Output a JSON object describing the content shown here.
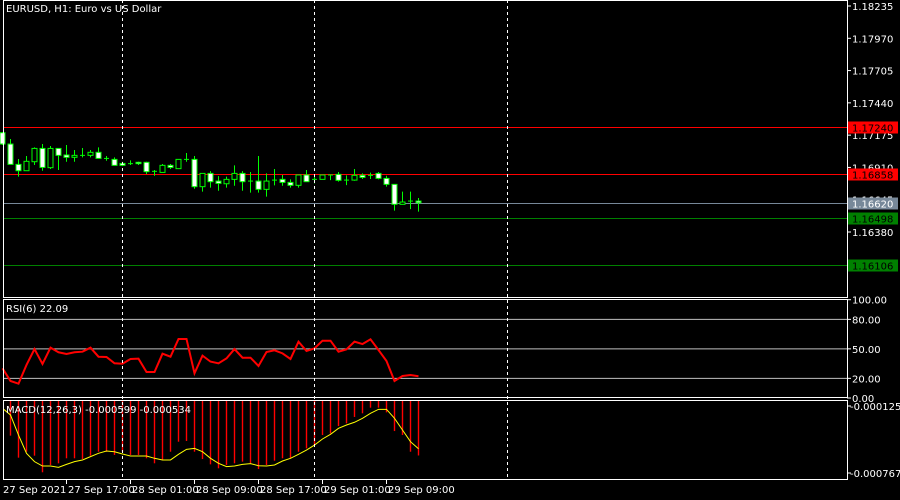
{
  "window": {
    "title": "EURUSD, H1:  Euro vs US Dollar"
  },
  "colors": {
    "background": "#000000",
    "bull": "#00ff00",
    "bear_fill": "#ffffff",
    "rsi": "#ff0000",
    "macd_hist": "#ff0000",
    "macd_signal": "#ffff00",
    "axis": "#ffffff",
    "grid": "#c0c0c0"
  },
  "chart_data": [
    {
      "type": "candlestick",
      "symbol": "EURUSD",
      "timeframe": "H1",
      "title": "EURUSD, H1:  Euro vs US Dollar",
      "ylim": [
        1.159,
        1.1828
      ],
      "y_ticks": [
        "1.18235",
        "1.17970",
        "1.17705",
        "1.17440",
        "1.17175",
        "1.16910",
        "1.16645",
        "1.16380"
      ],
      "x_ticks": [
        "27 Sep 2021",
        "27 Sep 17:00",
        "28 Sep 01:00",
        "28 Sep 09:00",
        "28 Sep 17:00",
        "29 Sep 01:00",
        "29 Sep 09:00"
      ],
      "day_separators": [
        "28 Sep 00:00",
        "29 Sep 00:00",
        "30 Sep 00:00"
      ],
      "ohlc": [
        [
          1.17195,
          1.17201,
          1.17094,
          1.17102
        ],
        [
          1.17102,
          1.17143,
          1.16935,
          1.16935
        ],
        [
          1.16935,
          1.16979,
          1.16834,
          1.16883
        ],
        [
          1.16883,
          1.17004,
          1.16883,
          1.1696
        ],
        [
          1.16957,
          1.17075,
          1.1693,
          1.17066
        ],
        [
          1.17066,
          1.17102,
          1.16883,
          1.1691
        ],
        [
          1.16908,
          1.17086,
          1.16897,
          1.17066
        ],
        [
          1.17066,
          1.17066,
          1.16889,
          1.17009
        ],
        [
          1.17012,
          1.17094,
          1.16957,
          1.16993
        ],
        [
          1.16993,
          1.17053,
          1.16957,
          1.17009
        ],
        [
          1.17009,
          1.17069,
          1.16993,
          1.17009
        ],
        [
          1.17009,
          1.17053,
          1.16993,
          1.17034
        ],
        [
          1.17034,
          1.17075,
          1.16984,
          1.16984
        ],
        [
          1.16984,
          1.17004,
          1.16965,
          1.16984
        ],
        [
          1.16976,
          1.16993,
          1.16927,
          1.16927
        ],
        [
          1.16943,
          1.16957,
          1.16921,
          1.16927
        ],
        [
          1.16941,
          1.16968,
          1.1693,
          1.16941
        ],
        [
          1.16952,
          1.16957,
          1.1693,
          1.16941
        ],
        [
          1.16952,
          1.16957,
          1.16856,
          1.16875
        ],
        [
          1.16878,
          1.16889,
          1.16842,
          1.16869
        ],
        [
          1.16869,
          1.16938,
          1.16869,
          1.16927
        ],
        [
          1.16927,
          1.16938,
          1.16897,
          1.1691
        ],
        [
          1.169,
          1.16976,
          1.169,
          1.16976
        ],
        [
          1.16976,
          1.17028,
          1.16957,
          1.16976
        ],
        [
          1.16976,
          1.17004,
          1.16735,
          1.16752
        ],
        [
          1.16752,
          1.16861,
          1.16711,
          1.16861
        ],
        [
          1.16861,
          1.1688,
          1.16744,
          1.16793
        ],
        [
          1.16798,
          1.16839,
          1.16719,
          1.16779
        ],
        [
          1.16776,
          1.16834,
          1.16744,
          1.16812
        ],
        [
          1.16812,
          1.16927,
          1.1676,
          1.16861
        ],
        [
          1.16861,
          1.1688,
          1.16719,
          1.16793
        ],
        [
          1.16798,
          1.16872,
          1.16703,
          1.16798
        ],
        [
          1.16798,
          1.17004,
          1.16703,
          1.1673
        ],
        [
          1.1673,
          1.16861,
          1.1667,
          1.16798
        ],
        [
          1.16806,
          1.16897,
          1.16763,
          1.16806
        ],
        [
          1.16812,
          1.16848,
          1.1676,
          1.16787
        ],
        [
          1.16787,
          1.16812,
          1.16744,
          1.16763
        ],
        [
          1.16763,
          1.16848,
          1.16744,
          1.16848
        ],
        [
          1.16848,
          1.16889,
          1.16793,
          1.16793
        ],
        [
          1.16812,
          1.16848,
          1.16779,
          1.16812
        ],
        [
          1.16812,
          1.16848,
          1.16812,
          1.16848
        ],
        [
          1.16848,
          1.16848,
          1.16806,
          1.16848
        ],
        [
          1.16853,
          1.16872,
          1.16793,
          1.16804
        ],
        [
          1.16806,
          1.16845,
          1.16765,
          1.16806
        ],
        [
          1.16806,
          1.16897,
          1.16801,
          1.16845
        ],
        [
          1.16845,
          1.16861,
          1.16815,
          1.16828
        ],
        [
          1.16845,
          1.16867,
          1.16815,
          1.16845
        ],
        [
          1.16861,
          1.16872,
          1.16812,
          1.1682
        ],
        [
          1.1682,
          1.16842,
          1.16752,
          1.16771
        ],
        [
          1.16771,
          1.16771,
          1.16555,
          1.16607
        ],
        [
          1.16607,
          1.16711,
          1.16607,
          1.16626
        ],
        [
          1.16634,
          1.16711,
          1.16568,
          1.16634
        ],
        [
          1.16634,
          1.16659,
          1.16547,
          1.1662
        ]
      ],
      "levels": [
        {
          "price": 1.1724,
          "label": "1.17240",
          "line": "#ff0000",
          "tag_bg": "#ff0000",
          "tag_fg": "#000000"
        },
        {
          "price": 1.16858,
          "label": "1.16858",
          "line": "#ff0000",
          "tag_bg": "#ff0000",
          "tag_fg": "#000000"
        },
        {
          "price": 1.1662,
          "label": "1.16620",
          "line": "#778899",
          "tag_bg": "#778899",
          "tag_fg": "#ffffff"
        },
        {
          "price": 1.16498,
          "label": "1.16498",
          "line": "#008000",
          "tag_bg": "#008000",
          "tag_fg": "#000000"
        },
        {
          "price": 1.16106,
          "label": "1.16106",
          "line": "#008000",
          "tag_bg": "#008000",
          "tag_fg": "#000000"
        }
      ]
    },
    {
      "type": "line",
      "title": "RSI(6) 22.09",
      "ylim": [
        0,
        100
      ],
      "y_ticks": [
        "100.00",
        "80.00",
        "50.00",
        "20.00",
        "0.00"
      ],
      "levels": [
        80,
        50,
        20
      ],
      "values": [
        30.2,
        17.3,
        14.6,
        33.6,
        49.8,
        34.6,
        51.2,
        46.5,
        44.8,
        46.5,
        47.1,
        51.2,
        42.0,
        41.7,
        35.3,
        34.9,
        39.7,
        40.0,
        26.4,
        26.4,
        45.1,
        42.0,
        60.0,
        60.0,
        25.1,
        43.1,
        37.0,
        35.3,
        40.3,
        49.8,
        41.0,
        41.0,
        32.6,
        46.8,
        48.5,
        45.4,
        39.7,
        57.3,
        47.8,
        50.5,
        58.3,
        58.3,
        47.1,
        49.5,
        57.3,
        54.9,
        59.7,
        48.8,
        37.6,
        17.3,
        22.4,
        23.4,
        22.09
      ]
    },
    {
      "type": "bar",
      "title": "MACD(12,26,3) -0.000599 -0.000534",
      "y_ticks": [
        "-0.000125",
        "-0.000767"
      ],
      "histogram": [
        -0.000179,
        -0.000409,
        -0.00062,
        -0.000563,
        -0.000601,
        -0.00076,
        -0.00069,
        -0.000674,
        -0.000626,
        -0.000626,
        -0.000633,
        -0.000601,
        -0.000563,
        -0.000563,
        -0.000594,
        -0.000563,
        -0.000594,
        -0.000594,
        -0.000626,
        -0.000674,
        -0.000642,
        -0.000563,
        -0.000467,
        -0.00046,
        -0.000563,
        -0.000633,
        -0.000684,
        -0.000722,
        -0.00069,
        -0.000674,
        -0.000658,
        -0.000674,
        -0.000729,
        -0.00069,
        -0.000649,
        -0.000626,
        -0.000626,
        -0.000563,
        -0.000531,
        -0.000499,
        -0.000403,
        -0.000387,
        -0.000317,
        -0.000291,
        -0.00023,
        -0.000195,
        -0.000141,
        -0.000141,
        -0.000186,
        -0.000365,
        -0.000403,
        -0.000563,
        -0.000599
      ],
      "signal": [
        -0.000147,
        -0.000211,
        -0.000403,
        -0.000578,
        -0.000658,
        -0.0007,
        -0.0007,
        -0.000713,
        -0.000684,
        -0.000658,
        -0.000642,
        -0.00061,
        -0.000578,
        -0.000556,
        -0.000563,
        -0.000585,
        -0.000604,
        -0.000604,
        -0.000604,
        -0.000626,
        -0.000642,
        -0.000642,
        -0.000588,
        -0.00054,
        -0.000531,
        -0.000563,
        -0.000626,
        -0.000674,
        -0.000706,
        -0.0007,
        -0.000684,
        -0.000677,
        -0.000697,
        -0.0007,
        -0.00069,
        -0.000652,
        -0.000626,
        -0.000588,
        -0.000547,
        -0.000499,
        -0.000441,
        -0.000396,
        -0.000339,
        -0.000307,
        -0.000281,
        -0.000243,
        -0.000195,
        -0.000157,
        -0.000157,
        -0.000243,
        -0.000355,
        -0.000467,
        -0.000534
      ]
    }
  ]
}
